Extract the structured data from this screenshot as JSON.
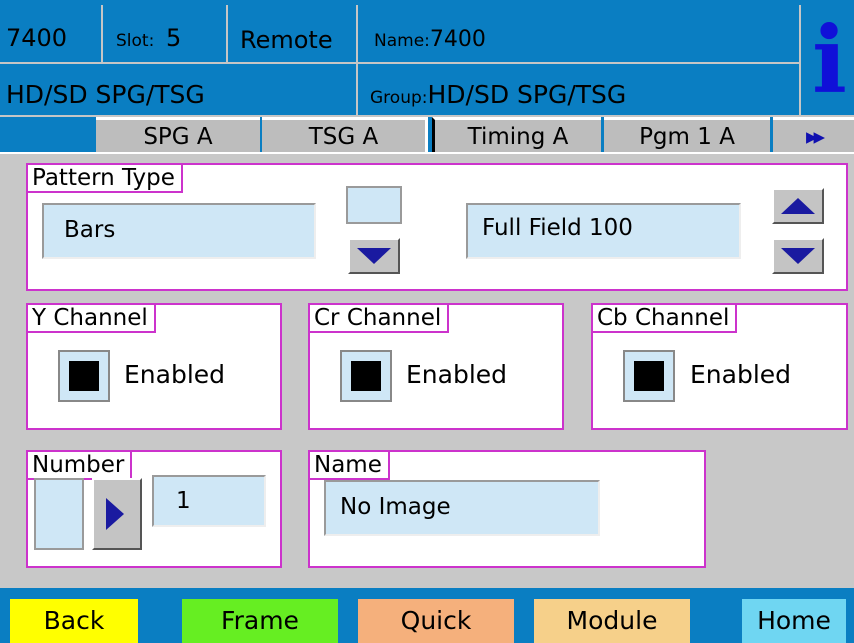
{
  "header": {
    "model": "7400",
    "slot_label": "Slot:",
    "slot_value": "5",
    "mode": "Remote",
    "name_label": "Name:",
    "name_value": "7400",
    "card_type": "HD/SD SPG/TSG",
    "group_label": "Group:",
    "group_value": "HD/SD SPG/TSG",
    "info_glyph": "i"
  },
  "tabs": [
    {
      "label": "SPG A"
    },
    {
      "label": "TSG A"
    },
    {
      "label": "Timing A"
    },
    {
      "label": "Pgm 1 A"
    }
  ],
  "tabs_more_glyph": "▸▸",
  "pattern_type": {
    "legend": "Pattern Type",
    "primary_value": "Bars",
    "secondary_value": "Full Field 100"
  },
  "channels": [
    {
      "legend": "Y Channel",
      "checkbox_label": "Enabled",
      "checked": true
    },
    {
      "legend": "Cr Channel",
      "checkbox_label": "Enabled",
      "checked": true
    },
    {
      "legend": "Cb Channel",
      "checkbox_label": "Enabled",
      "checked": true
    }
  ],
  "number": {
    "legend": "Number",
    "value": "1"
  },
  "name_panel": {
    "legend": "Name",
    "value": "No Image"
  },
  "bottom_bar": {
    "back": "Back",
    "frame": "Frame",
    "quick": "Quick",
    "module": "Module",
    "home": "Home"
  },
  "colors": {
    "header_blue": "#0a7ec2",
    "panel_border": "#cc33cc",
    "field_fill": "#cfe7f6",
    "back_btn": "#ffff00",
    "frame_btn": "#66ee22",
    "quick_btn": "#f5b07c",
    "module_btn": "#f6d08a",
    "home_btn": "#6fd6f2"
  }
}
